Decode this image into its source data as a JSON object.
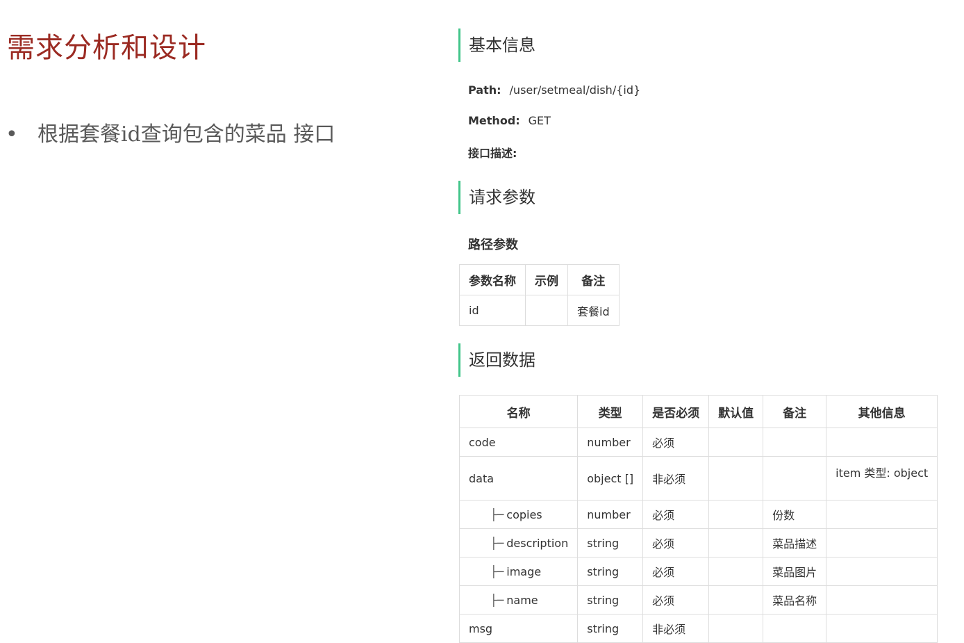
{
  "slide": {
    "title": "需求分析和设计",
    "bullet_marker": "•",
    "bullet_text": "根据套餐id查询包含的菜品 接口"
  },
  "api": {
    "basic_info_title": "基本信息",
    "path_label": "Path:",
    "path_value": "/user/setmeal/dish/{id}",
    "method_label": "Method:",
    "method_value": "GET",
    "desc_label": "接口描述:",
    "request_title": "请求参数",
    "path_params_title": "路径参数",
    "path_params": {
      "headers": [
        "参数名称",
        "示例",
        "备注"
      ],
      "rows": [
        [
          "id",
          "",
          "套餐id"
        ]
      ]
    },
    "response_title": "返回数据",
    "response": {
      "headers": [
        "名称",
        "类型",
        "是否必须",
        "默认值",
        "备注",
        "其他信息"
      ],
      "tree_glyph": "├─",
      "rows": [
        {
          "name": "code",
          "type": "number",
          "required": "必须",
          "default": "",
          "note": "",
          "other": "",
          "child": false
        },
        {
          "name": "data",
          "type": "object []",
          "required": "非必须",
          "default": "",
          "note": "",
          "other": "item 类型: object",
          "child": false
        },
        {
          "name": "copies",
          "type": "number",
          "required": "必须",
          "default": "",
          "note": "份数",
          "other": "",
          "child": true
        },
        {
          "name": "description",
          "type": "string",
          "required": "必须",
          "default": "",
          "note": "菜品描述",
          "other": "",
          "child": true
        },
        {
          "name": "image",
          "type": "string",
          "required": "必须",
          "default": "",
          "note": "菜品图片",
          "other": "",
          "child": true
        },
        {
          "name": "name",
          "type": "string",
          "required": "必须",
          "default": "",
          "note": "菜品名称",
          "other": "",
          "child": true
        },
        {
          "name": "msg",
          "type": "string",
          "required": "非必须",
          "default": "",
          "note": "",
          "other": "",
          "child": false
        }
      ]
    }
  },
  "colors": {
    "title_red": "#9b2a22",
    "accent_green": "#42c58a",
    "border_gray": "#dddddd"
  }
}
